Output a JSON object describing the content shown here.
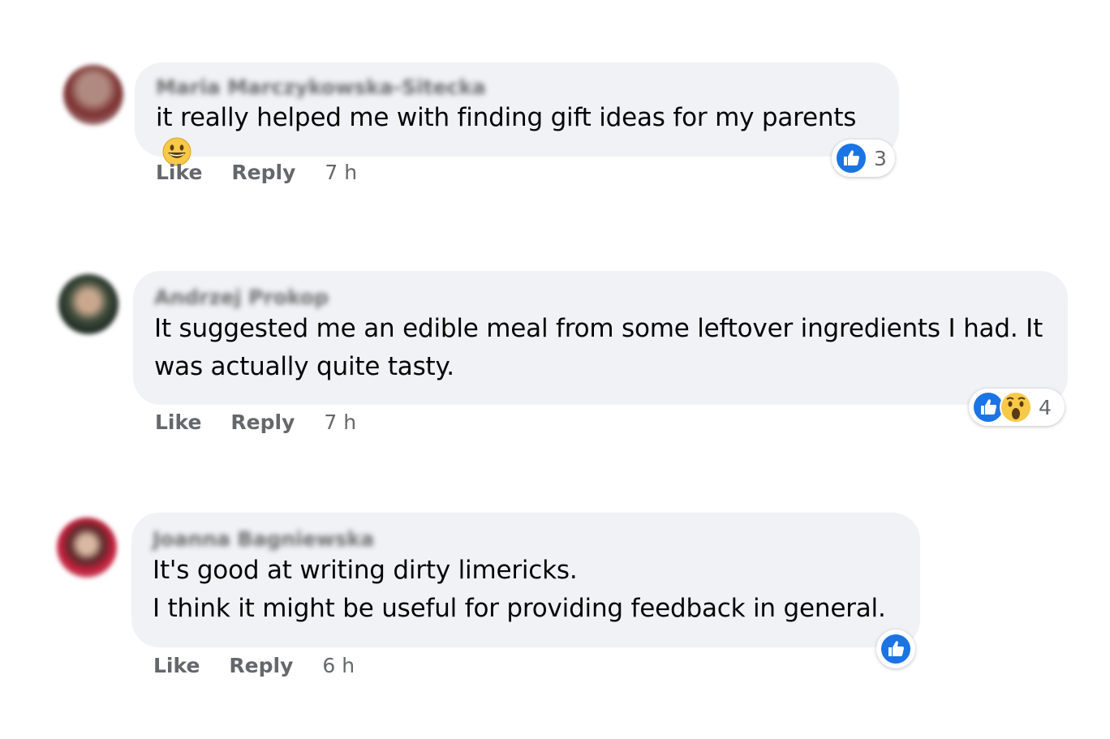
{
  "colors": {
    "bubble_bg": "#f0f2f5",
    "like_blue": "#1b74e4",
    "meta_gray": "#65676b"
  },
  "comments": [
    {
      "author": "Maria Marczykowska-Sitecka",
      "text": "it really helped me with finding gift ideas for my parents",
      "inline_emoji": "grinning-face-icon",
      "actions": {
        "like": "Like",
        "reply": "Reply",
        "time": "7 h"
      },
      "reactions": {
        "icons": [
          "like-icon"
        ],
        "count": "3"
      }
    },
    {
      "author": "Andrzej Prokop",
      "text": "It suggested me an edible meal from some leftover ingredients I had. It was actually quite tasty.",
      "actions": {
        "like": "Like",
        "reply": "Reply",
        "time": "7 h"
      },
      "reactions": {
        "icons": [
          "like-icon",
          "wow-icon"
        ],
        "count": "4"
      }
    },
    {
      "author": "Joanna Bagniewska",
      "text": "It's good at writing dirty limericks.\nI think it might be useful for providing feedback in general.",
      "actions": {
        "like": "Like",
        "reply": "Reply",
        "time": "6 h"
      },
      "reactions": {
        "icons": [
          "like-icon"
        ],
        "count": ""
      }
    }
  ]
}
